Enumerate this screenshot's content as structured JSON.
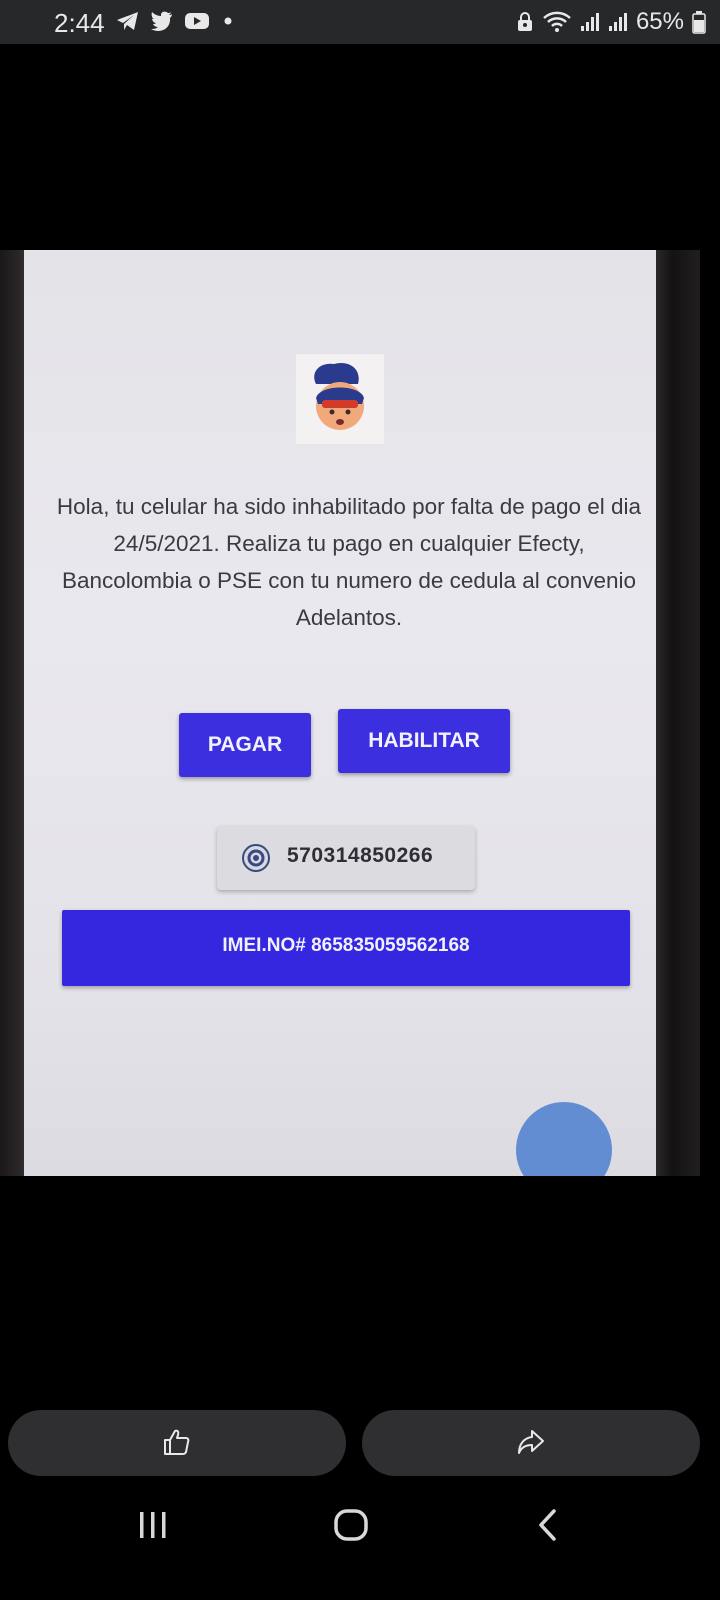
{
  "status_bar": {
    "time": "2:44",
    "left_icons": [
      "telegram-icon",
      "twitter-icon",
      "youtube-icon",
      "dot-icon"
    ],
    "right_icons": [
      "lock-icon",
      "wifi-icon",
      "signal-icon",
      "signal-icon"
    ],
    "battery_text": "65%"
  },
  "photo": {
    "message": "Hola, tu celular ha sido inhabilitado por falta de pago el dia 24/5/2021. Realiza tu pago en cualquier Efecty, Bancolombia o PSE con tu numero de cedula al convenio Adelantos.",
    "buttons": {
      "pagar": "PAGAR",
      "habilitar": "HABILITAR"
    },
    "contact_number": "570314850266",
    "imei": "IMEI.NO# 865835059562168",
    "colors": {
      "button_blue": "#3b2fe0",
      "screen_bg": "#e6e5ea"
    }
  },
  "actions": {
    "like_icon": "thumbs-up-icon",
    "share_icon": "share-icon"
  },
  "navbar": {
    "recents_icon": "recents-icon",
    "home_icon": "home-icon",
    "back_icon": "back-icon"
  }
}
